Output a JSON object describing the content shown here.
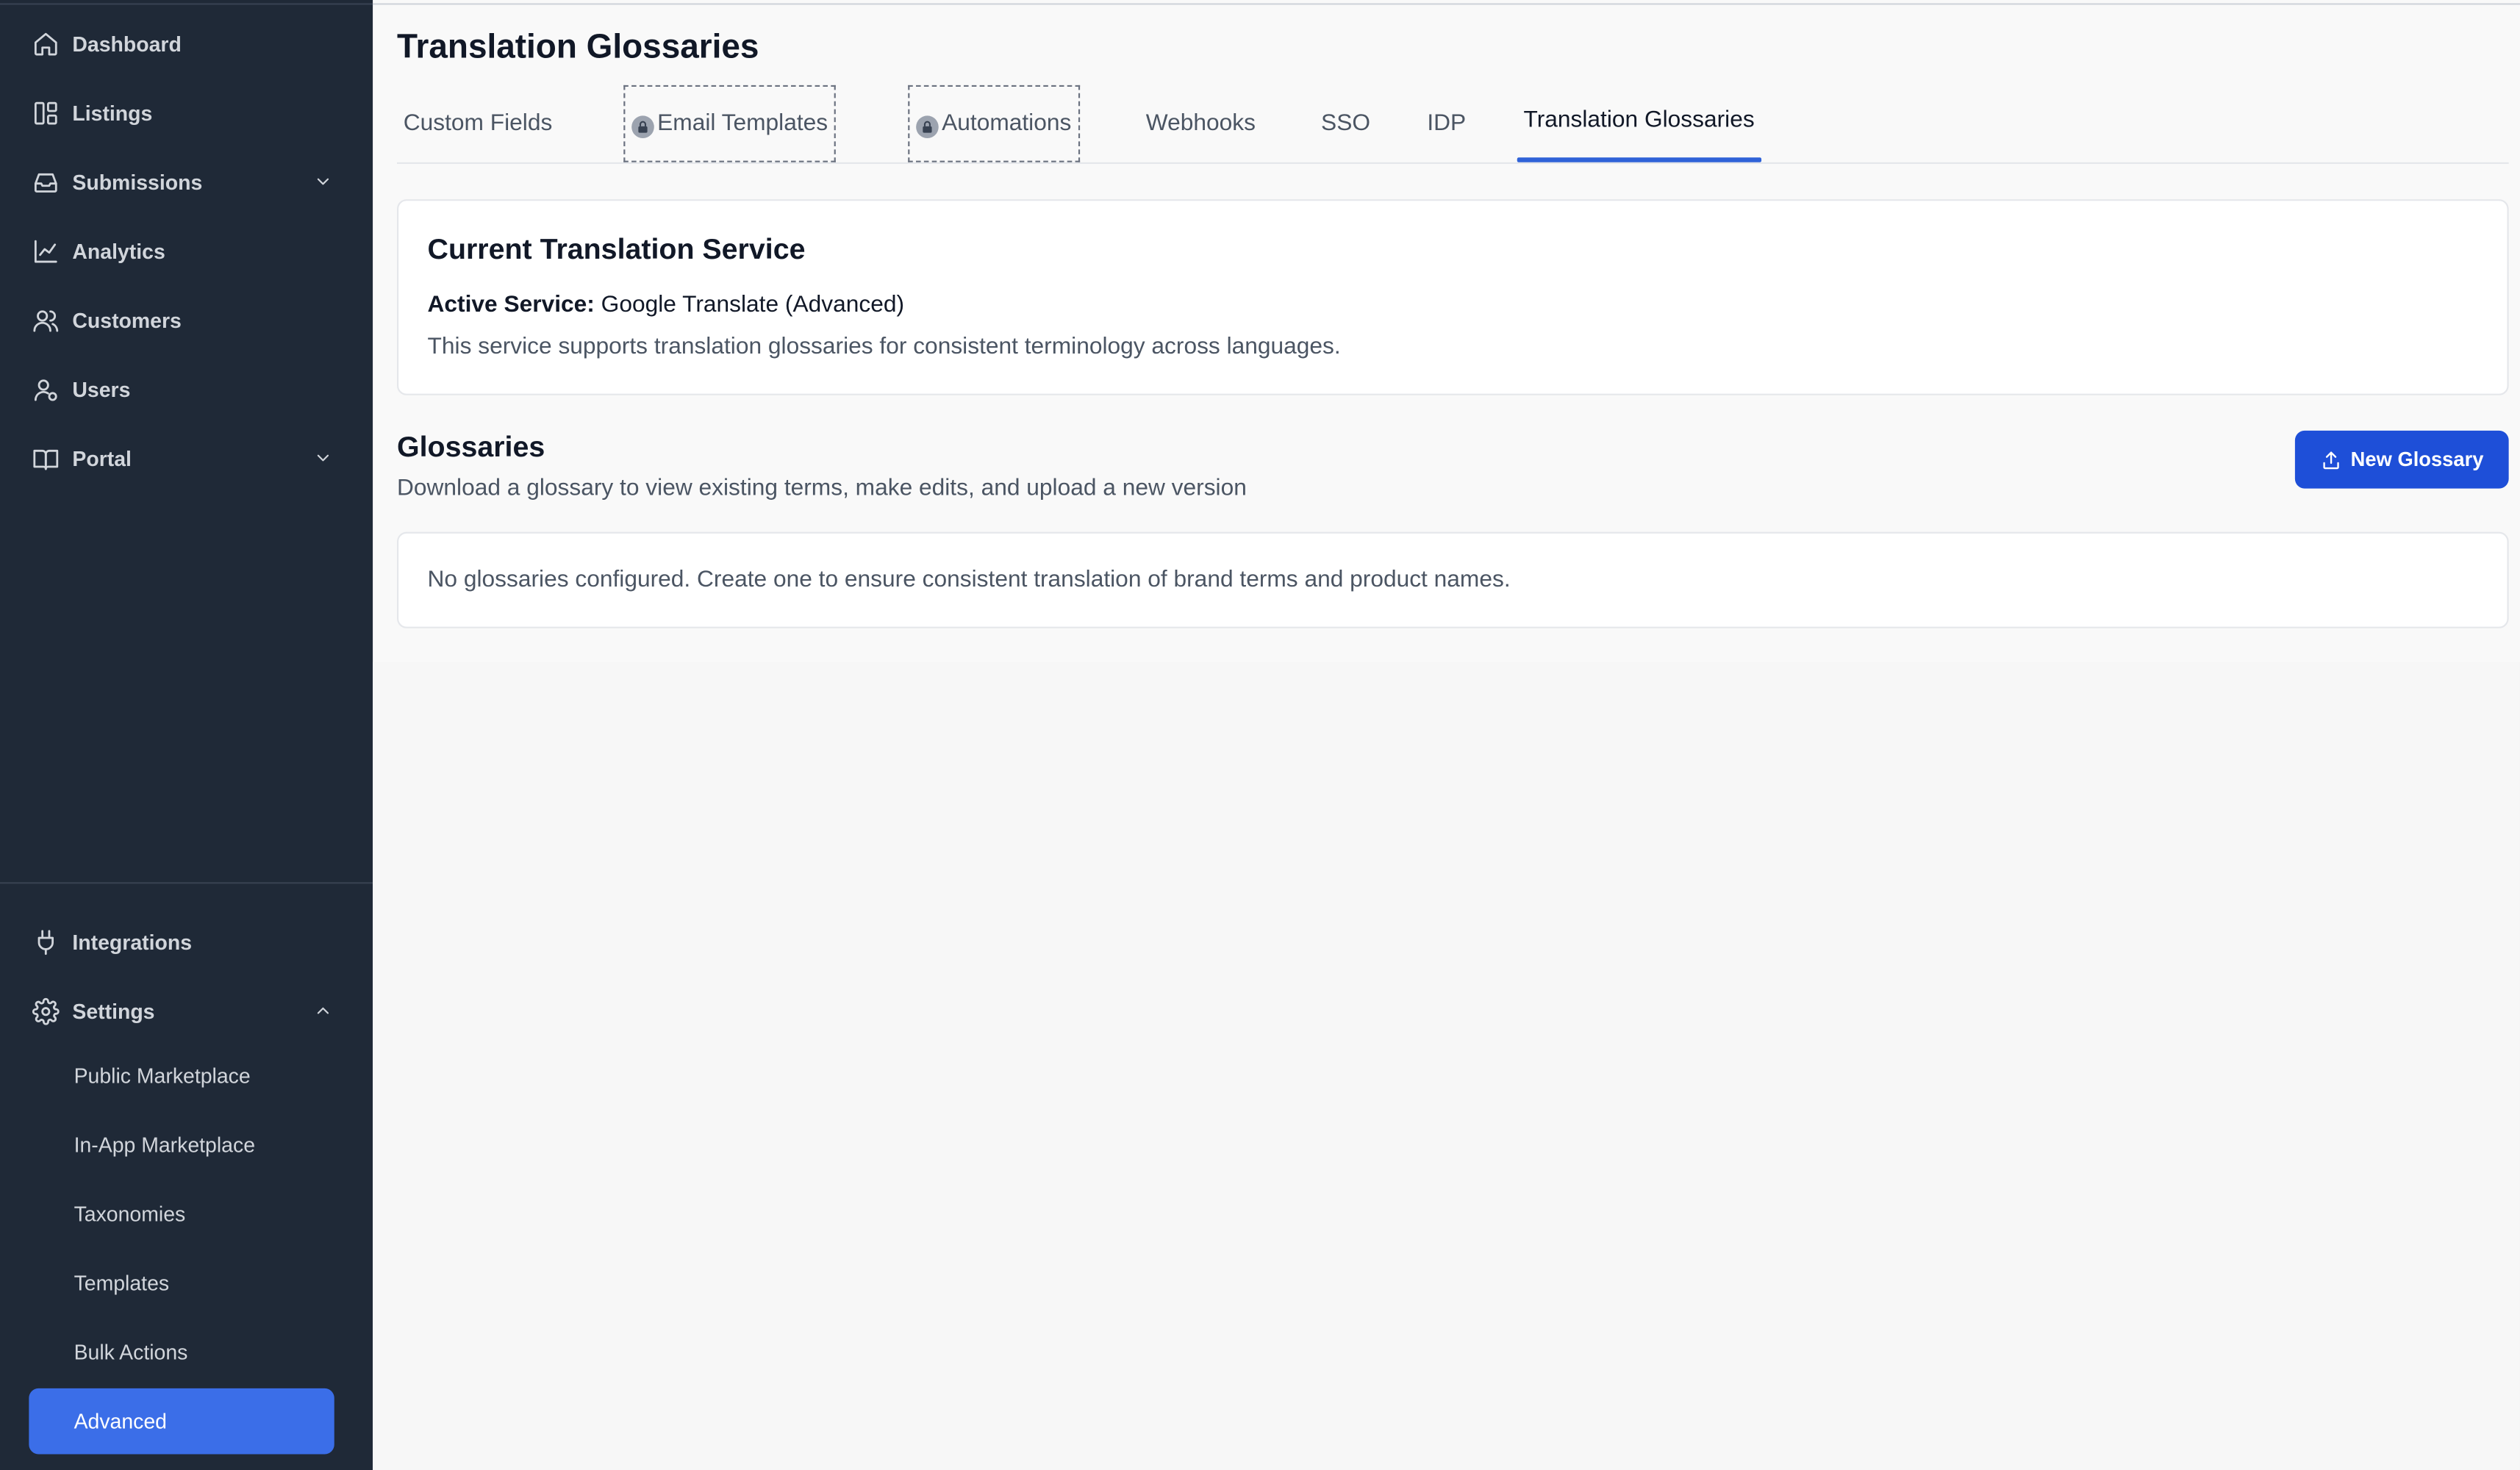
{
  "sidebar": {
    "items": [
      {
        "label": "Dashboard",
        "icon": "home-icon"
      },
      {
        "label": "Listings",
        "icon": "layout-icon"
      },
      {
        "label": "Submissions",
        "icon": "inbox-icon"
      },
      {
        "label": "Analytics",
        "icon": "chart-line-icon"
      },
      {
        "label": "Customers",
        "icon": "users-icon"
      },
      {
        "label": "Users",
        "icon": "user-gear-icon"
      },
      {
        "label": "Portal",
        "icon": "book-icon"
      }
    ],
    "bottom_items": [
      {
        "label": "Integrations",
        "icon": "plug-icon"
      },
      {
        "label": "Settings",
        "icon": "gear-icon"
      }
    ],
    "settings_sub": [
      {
        "label": "Public Marketplace"
      },
      {
        "label": "In-App Marketplace"
      },
      {
        "label": "Taxonomies"
      },
      {
        "label": "Templates"
      },
      {
        "label": "Bulk Actions"
      },
      {
        "label": "Advanced"
      }
    ],
    "active_color": "#3b6ee8"
  },
  "page": {
    "title": "Translation Glossaries",
    "tabs": [
      {
        "label": "Custom Fields"
      },
      {
        "label": "Email Templates",
        "locked": true
      },
      {
        "label": "Automations",
        "locked": true
      },
      {
        "label": "Webhooks"
      },
      {
        "label": "SSO"
      },
      {
        "label": "IDP"
      },
      {
        "label": "Translation Glossaries",
        "active": true
      }
    ]
  },
  "service_card": {
    "title": "Current Translation Service",
    "active_label": "Active Service:",
    "active_value": "Google Translate (Advanced)",
    "description": "This service supports translation glossaries for consistent terminology across languages."
  },
  "glossaries": {
    "title": "Glossaries",
    "subtitle": "Download a glossary to view existing terms, make edits, and upload a new version",
    "new_button": "New Glossary",
    "empty_message": "No glossaries configured. Create one to ensure consistent translation of brand terms and product names."
  }
}
